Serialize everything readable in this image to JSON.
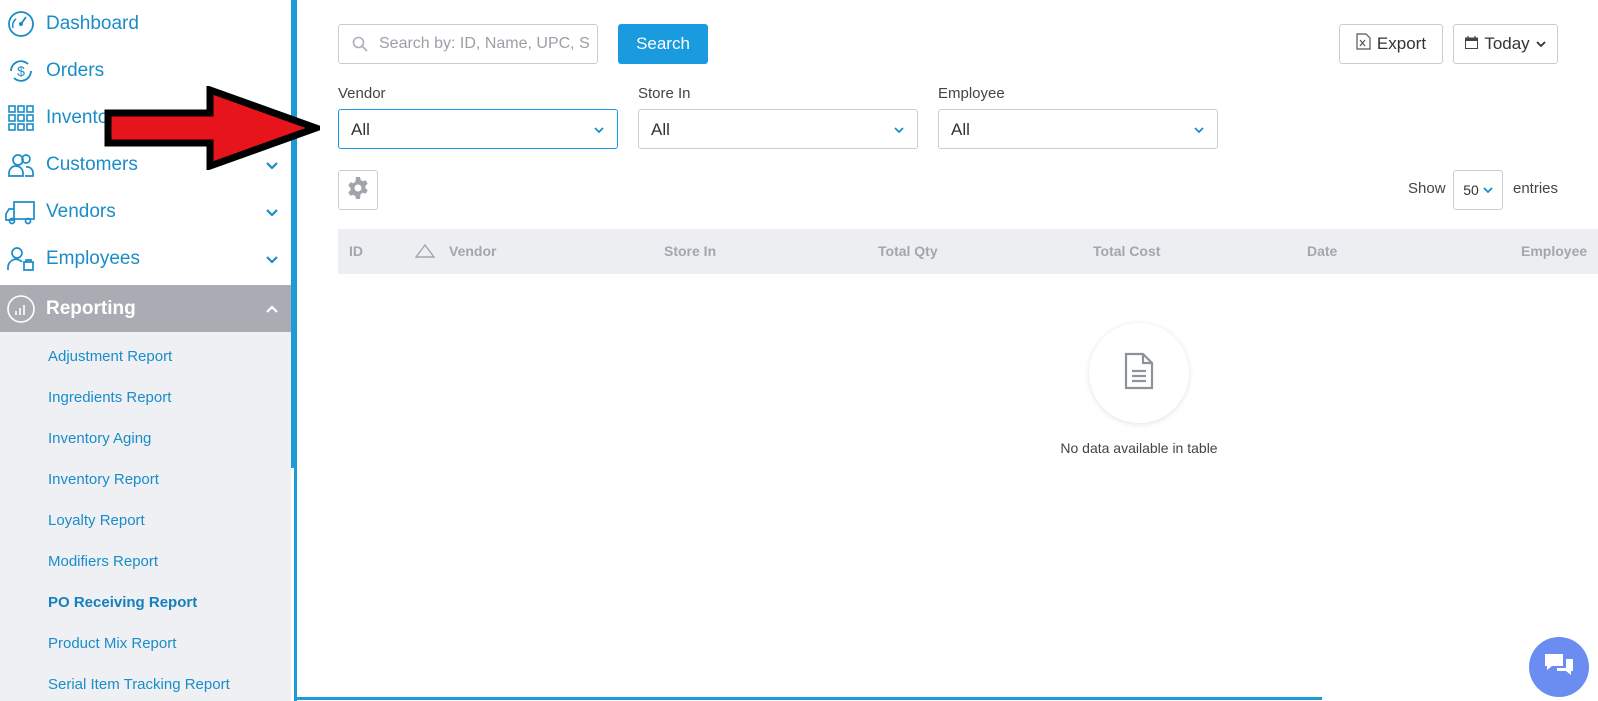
{
  "sidebar": {
    "items": [
      {
        "label": "Dashboard",
        "icon": "dashboard-icon"
      },
      {
        "label": "Orders",
        "icon": "dollar-refresh-icon"
      },
      {
        "label": "Inventory",
        "icon": "grid-icon"
      },
      {
        "label": "Customers",
        "icon": "users-icon"
      },
      {
        "label": "Vendors",
        "icon": "truck-icon"
      },
      {
        "label": "Employees",
        "icon": "employee-icon"
      },
      {
        "label": "Reporting",
        "icon": "report-chart-icon"
      }
    ],
    "submenu": [
      "Adjustment Report",
      "Ingredients Report",
      "Inventory Aging",
      "Inventory Report",
      "Loyalty Report",
      "Modifiers Report",
      "PO Receiving Report",
      "Product Mix Report",
      "Serial Item Tracking Report"
    ]
  },
  "toolbar": {
    "search_placeholder": "Search by: ID, Name, UPC, S",
    "search_button": "Search",
    "export_button": "Export",
    "date_range": "Today"
  },
  "filters": {
    "vendor": {
      "label": "Vendor",
      "value": "All"
    },
    "store": {
      "label": "Store In",
      "value": "All"
    },
    "employee": {
      "label": "Employee",
      "value": "All"
    }
  },
  "entries": {
    "show_label": "Show",
    "count": "50",
    "suffix": "entries"
  },
  "table": {
    "columns": [
      "ID",
      "Vendor",
      "Store In",
      "Total Qty",
      "Total Cost",
      "Date",
      "Employee"
    ],
    "empty_message": "No data available in table"
  },
  "colors": {
    "accent": "#1a9be0",
    "link": "#1a8dc8",
    "active_nav": "#a9adb3",
    "arrow": "#e8141c"
  }
}
